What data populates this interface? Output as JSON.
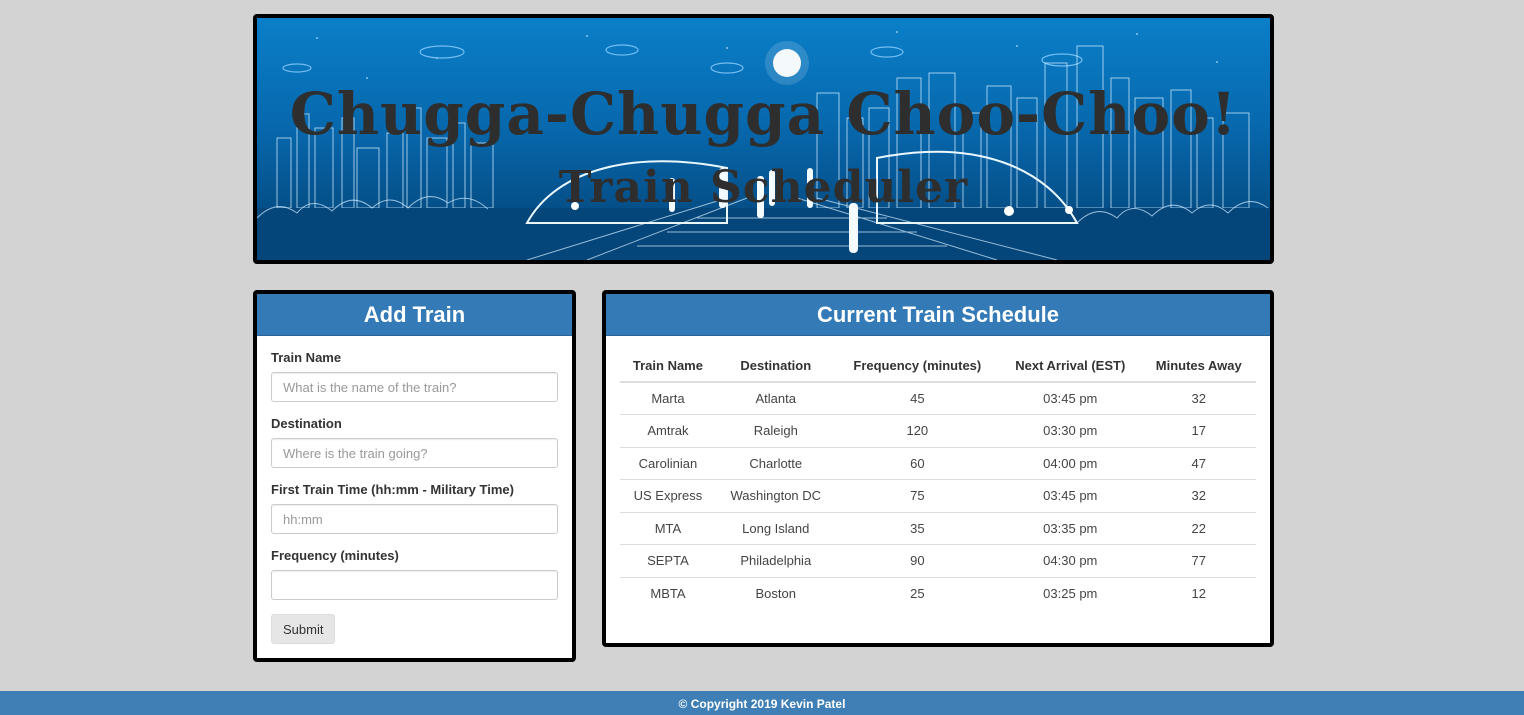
{
  "banner": {
    "title": "Chugga-Chugga Choo-Choo!",
    "subtitle": "Train Scheduler"
  },
  "add_train": {
    "heading": "Add Train",
    "fields": [
      {
        "label": "Train Name",
        "placeholder": "What is the name of the train?",
        "value": ""
      },
      {
        "label": "Destination",
        "placeholder": "Where is the train going?",
        "value": ""
      },
      {
        "label": "First Train Time (hh:mm - Military Time)",
        "placeholder": "hh:mm",
        "value": ""
      },
      {
        "label": "Frequency (minutes)",
        "placeholder": "",
        "value": ""
      }
    ],
    "submit_label": "Submit"
  },
  "schedule": {
    "heading": "Current Train Schedule",
    "columns": [
      "Train Name",
      "Destination",
      "Frequency (minutes)",
      "Next Arrival (EST)",
      "Minutes Away"
    ],
    "rows": [
      [
        "Marta",
        "Atlanta",
        "45",
        "03:45 pm",
        "32"
      ],
      [
        "Amtrak",
        "Raleigh",
        "120",
        "03:30 pm",
        "17"
      ],
      [
        "Carolinian",
        "Charlotte",
        "60",
        "04:00 pm",
        "47"
      ],
      [
        "US Express",
        "Washington DC",
        "75",
        "03:45 pm",
        "32"
      ],
      [
        "MTA",
        "Long Island",
        "35",
        "03:35 pm",
        "22"
      ],
      [
        "SEPTA",
        "Philadelphia",
        "90",
        "04:30 pm",
        "77"
      ],
      [
        "MBTA",
        "Boston",
        "25",
        "03:25 pm",
        "12"
      ]
    ]
  },
  "footer": {
    "text": "© Copyright 2019 Kevin Patel"
  },
  "colors": {
    "page_bg": "#d3d3d3",
    "header_blue": "#337ab7",
    "footer_blue": "#3f7fb6",
    "banner_blue": "#0768ad"
  }
}
